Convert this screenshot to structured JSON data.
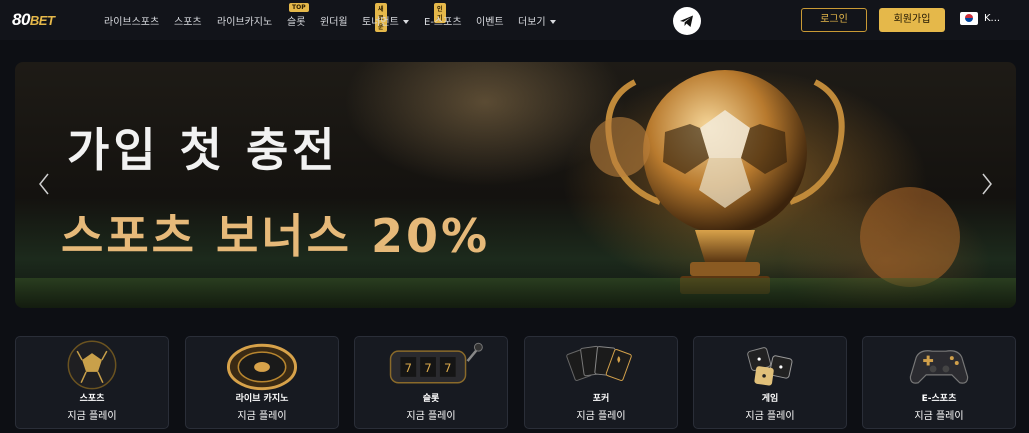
{
  "header": {
    "logo_number": "80",
    "logo_text": "BET",
    "nav": [
      {
        "label": "라이브스포츠",
        "badge": "",
        "dropdown": false
      },
      {
        "label": "스포츠",
        "badge": "",
        "dropdown": false
      },
      {
        "label": "라이브카지노",
        "badge": "",
        "dropdown": false
      },
      {
        "label": "슬롯",
        "badge": "TOP",
        "dropdown": false
      },
      {
        "label": "윈더윌",
        "badge": "",
        "dropdown": false
      },
      {
        "label": "토너먼트",
        "badge": "새로운",
        "dropdown": true
      },
      {
        "label": "E-스포츠",
        "badge": "인기",
        "dropdown": false
      },
      {
        "label": "이벤트",
        "badge": "",
        "dropdown": false
      },
      {
        "label": "더보기",
        "badge": "",
        "dropdown": true
      }
    ],
    "login_label": "로그인",
    "join_label": "회원가입",
    "language": "K..."
  },
  "banner": {
    "line1": "가입 첫 충전",
    "line2": "스포츠 보너스 20%"
  },
  "tiles": [
    {
      "label": "스포츠",
      "action": "지금 플레이",
      "icon": "soccer-ball-icon"
    },
    {
      "label": "라이브 카지노",
      "action": "지금 플레이",
      "icon": "roulette-icon"
    },
    {
      "label": "슬롯",
      "action": "지금 플레이",
      "icon": "slot-machine-icon"
    },
    {
      "label": "포커",
      "action": "지금 플레이",
      "icon": "playing-cards-icon"
    },
    {
      "label": "게임",
      "action": "지금 플레이",
      "icon": "dice-icon"
    },
    {
      "label": "E-스포츠",
      "action": "지금 플레이",
      "icon": "gamepad-icon"
    }
  ],
  "colors": {
    "accent_gold": "#e5b84a",
    "background": "#0d0f14",
    "header": "#12141a"
  }
}
